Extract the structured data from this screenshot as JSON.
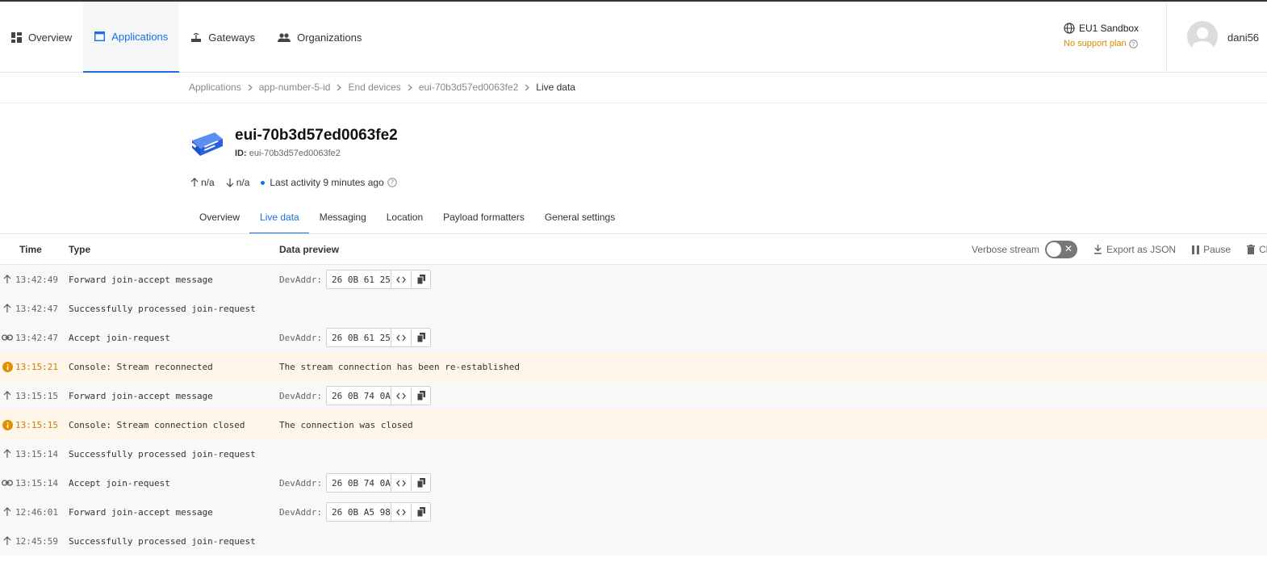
{
  "nav": {
    "items": [
      {
        "label": "Overview",
        "icon": "dashboard-icon"
      },
      {
        "label": "Applications",
        "icon": "application-window-icon",
        "active": true
      },
      {
        "label": "Gateways",
        "icon": "router-icon"
      },
      {
        "label": "Organizations",
        "icon": "people-icon"
      }
    ]
  },
  "header": {
    "cluster": "EU1 Sandbox",
    "support": "No support plan",
    "username": "dani56"
  },
  "breadcrumb": [
    "Applications",
    "app-number-5-id",
    "End devices",
    "eui-70b3d57ed0063fe2",
    "Live data"
  ],
  "device": {
    "title": "eui-70b3d57ed0063fe2",
    "id_label": "ID:",
    "id_value": "eui-70b3d57ed0063fe2",
    "uplink": "n/a",
    "downlink": "n/a",
    "last_activity": "Last activity 9 minutes ago"
  },
  "tabs": [
    "Overview",
    "Live data",
    "Messaging",
    "Location",
    "Payload formatters",
    "General settings"
  ],
  "table": {
    "headers": {
      "time": "Time",
      "type": "Type",
      "preview": "Data preview"
    },
    "verbose_label": "Verbose stream",
    "export_label": "Export as JSON",
    "pause_label": "Pause",
    "clear_label": "Cle",
    "devaddr_label": "DevAddr:",
    "rows": [
      {
        "icon": "arrow-up-icon",
        "time": "13:42:49",
        "type": "Forward join-accept message",
        "devaddr": "26 0B 61 25"
      },
      {
        "icon": "arrow-up-icon",
        "time": "13:42:47",
        "type": "Successfully processed join-request"
      },
      {
        "icon": "link-icon",
        "time": "13:42:47",
        "type": "Accept join-request",
        "devaddr": "26 0B 61 25"
      },
      {
        "icon": "info-icon",
        "time": "13:15:21",
        "type": "Console: Stream reconnected",
        "text": "The stream connection has been re-established",
        "warn": true
      },
      {
        "icon": "arrow-up-icon",
        "time": "13:15:15",
        "type": "Forward join-accept message",
        "devaddr": "26 0B 74 0A"
      },
      {
        "icon": "info-icon",
        "time": "13:15:15",
        "type": "Console: Stream connection closed",
        "text": "The connection was closed",
        "warn": true
      },
      {
        "icon": "arrow-up-icon",
        "time": "13:15:14",
        "type": "Successfully processed join-request"
      },
      {
        "icon": "link-icon",
        "time": "13:15:14",
        "type": "Accept join-request",
        "devaddr": "26 0B 74 0A"
      },
      {
        "icon": "arrow-up-icon",
        "time": "12:46:01",
        "type": "Forward join-accept message",
        "devaddr": "26 0B A5 98"
      },
      {
        "icon": "arrow-up-icon",
        "time": "12:45:59",
        "type": "Successfully processed join-request"
      }
    ]
  }
}
